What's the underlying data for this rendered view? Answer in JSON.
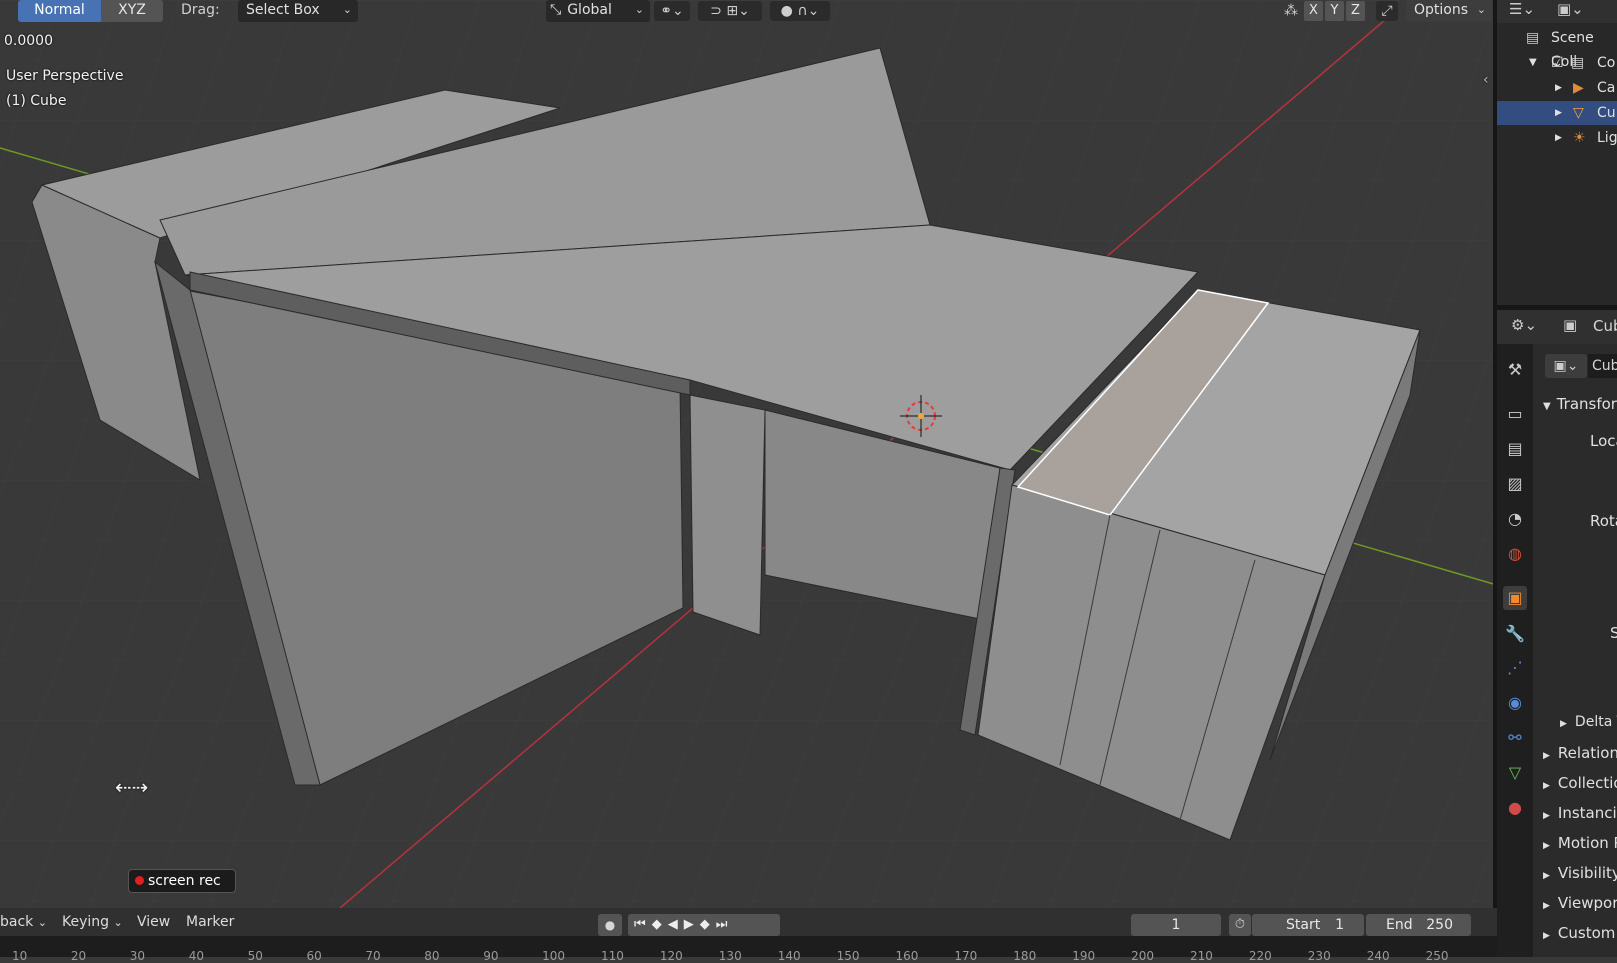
{
  "header": {
    "mode_normal": "Normal",
    "mode_xyz": "XYZ",
    "drag_label": "Drag:",
    "drag_value": "Select Box",
    "transform_orientation": "Global",
    "axis_x": "X",
    "axis_y": "Y",
    "axis_z": "Z",
    "options_label": "Options"
  },
  "viewport": {
    "value_readout": "0.0000",
    "perspective_label": "User Perspective",
    "object_label": "(1) Cube",
    "screenrec_label": "screen rec"
  },
  "outliner": {
    "items": [
      {
        "label": "Scene Coll",
        "icon": "scene-collection-icon"
      },
      {
        "label": "Co",
        "icon": "collection-icon"
      },
      {
        "label": "Ca",
        "icon": "camera-icon"
      },
      {
        "label": "Cu",
        "icon": "mesh-icon"
      },
      {
        "label": "Lig",
        "icon": "light-icon"
      }
    ]
  },
  "properties": {
    "object_name": "Cub",
    "data_name": "Cub",
    "transform_label": "Transfor",
    "location_label": "Loca",
    "rotation_label": "Rota",
    "scale_label": "S",
    "delta_label": "Delta T",
    "panels": [
      "Relation",
      "Collectio",
      "Instanci",
      "Motion P",
      "Visibility",
      "Viewpor",
      "Custom"
    ]
  },
  "timeline": {
    "playback_label": "back",
    "keying_label": "Keying",
    "view_label": "View",
    "marker_label": "Marker",
    "current_frame": "1",
    "start_label": "Start",
    "start_value": "1",
    "end_label": "End",
    "end_value": "250",
    "ticks": [
      "10",
      "20",
      "30",
      "40",
      "50",
      "60",
      "70",
      "80",
      "90",
      "100",
      "110",
      "120",
      "130",
      "140",
      "150",
      "160",
      "170",
      "180",
      "190",
      "200",
      "210",
      "220",
      "230",
      "240",
      "250"
    ]
  },
  "colors": {
    "viewport_bg": "#393939",
    "x_axis": "#c23a4a",
    "y_axis": "#7aa02c",
    "selection_blue": "#4772b3",
    "selected_face": "#a9a19c"
  }
}
